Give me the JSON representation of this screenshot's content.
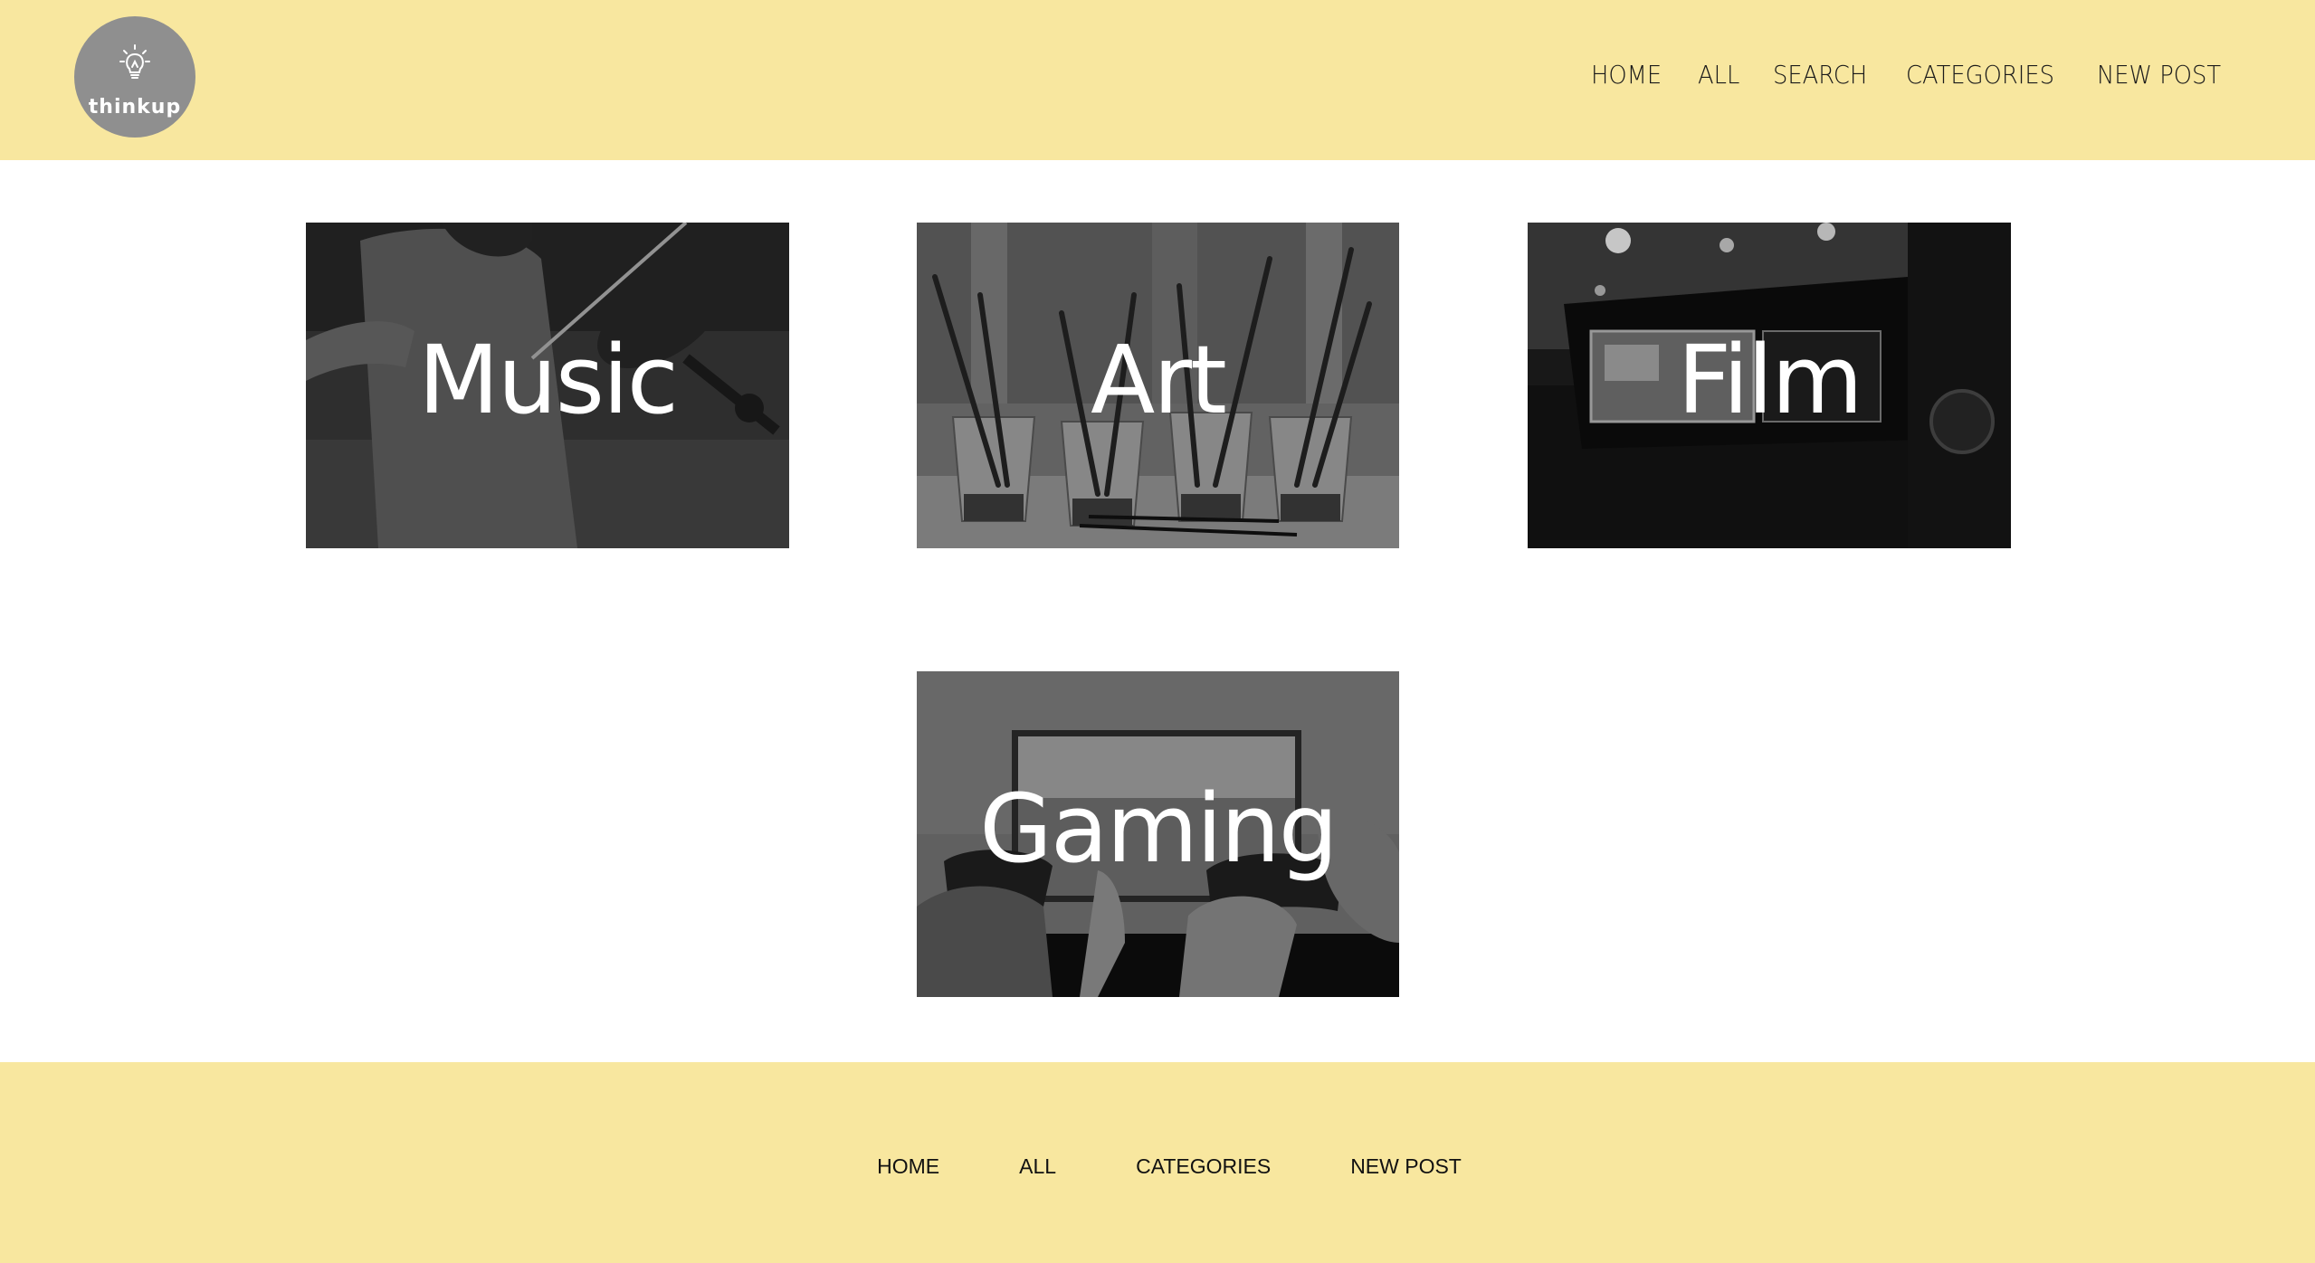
{
  "brand": {
    "logo_text": "thinkup"
  },
  "header_nav": {
    "items": [
      "HOME",
      "ALL",
      "SEARCH",
      "CATEGORIES",
      "NEW POST"
    ]
  },
  "categories": [
    {
      "label": "Music"
    },
    {
      "label": "Art"
    },
    {
      "label": "Film"
    },
    {
      "label": "Gaming"
    }
  ],
  "footer_nav": {
    "items": [
      "HOME",
      "ALL",
      "CATEGORIES",
      "NEW POST"
    ]
  },
  "colors": {
    "header_bg": "#f8e79f",
    "footer_bg": "#f8e79f",
    "logo_bg": "#8f8f8f"
  }
}
